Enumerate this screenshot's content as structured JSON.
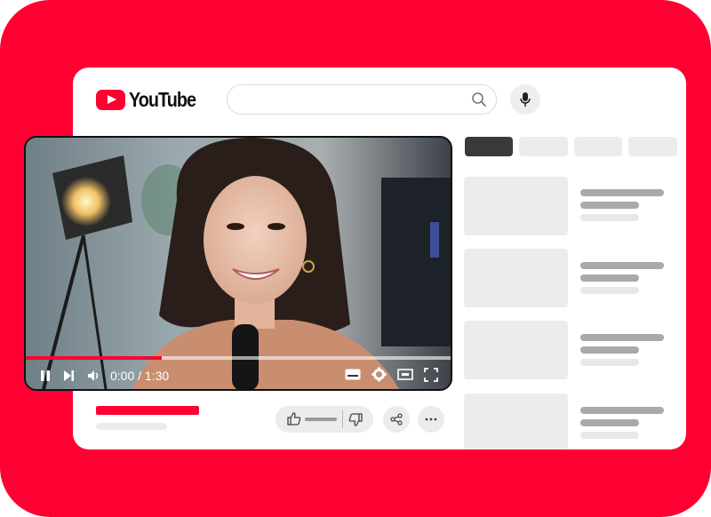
{
  "app": {
    "brand": "YouTube"
  },
  "search": {
    "placeholder": ""
  },
  "player": {
    "time_label": "0:00 / 1:30",
    "progress": 0.32
  },
  "icons": {
    "search": "search-icon",
    "mic": "microphone-icon",
    "pause": "pause-icon",
    "next": "next-icon",
    "volume": "volume-icon",
    "captions": "captions-icon",
    "settings": "gear-icon",
    "theater": "theater-mode-icon",
    "fullscreen": "fullscreen-icon",
    "like": "thumbs-up-icon",
    "dislike": "thumbs-down-icon",
    "share": "share-icon",
    "more": "more-icon"
  },
  "colors": {
    "brand_red": "#ff0033",
    "chip_active": "#3a3a3a",
    "placeholder_gray": "#ececec",
    "line_gray": "#a9a9a9"
  }
}
